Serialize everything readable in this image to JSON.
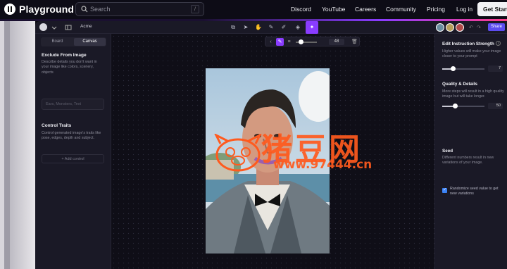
{
  "topnav": {
    "brand": "Playground",
    "search_placeholder": "Search",
    "search_shortcut": "/",
    "links": [
      "Discord",
      "YouTube",
      "Careers",
      "Community",
      "Pricing",
      "Log in"
    ],
    "cta": "Get Start"
  },
  "editor": {
    "project_name": "Acme",
    "share_label": "Share",
    "toolbar_value": "48"
  },
  "left_panel": {
    "tabs": [
      "Board",
      "Canvas"
    ],
    "active_tab": "Canvas",
    "exclude_title": "Exclude From Image",
    "exclude_desc": "Describe details you don't want in your image like colors, scenery, objects",
    "exclude_placeholder": "Ears, Monsters, Text",
    "control_title": "Control Traits",
    "control_desc": "Control generated image's traits like pose, edges, depth and subject.",
    "add_control": "+ Add control"
  },
  "right_panel": {
    "instruction_title": "Edit Instruction Strength",
    "instruction_desc": "Higher values will make your image closer to your prompt",
    "instruction_value": "7",
    "instruction_level": 0.25,
    "quality_title": "Quality & Details",
    "quality_desc": "More steps will result in a high quality image but will take longer.",
    "quality_value": "50",
    "quality_level": 0.3,
    "seed_title": "Seed",
    "seed_desc": "Different numbers result in new variations of your image.",
    "randomize_label": "Randomize seed value to get new variations",
    "randomize_checked": true
  },
  "watermark": {
    "main": "猪豆网",
    "sub": "www.97444.cn"
  },
  "colors": {
    "accent": "#8a3cff",
    "share": "#5c4cf0",
    "watermark": "#ff5a1e"
  }
}
